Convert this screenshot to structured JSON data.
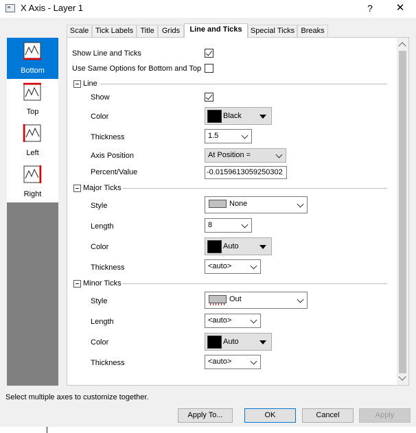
{
  "window": {
    "title": "X Axis - Layer 1",
    "help": "?",
    "close": "✕"
  },
  "axes": [
    {
      "label": "Bottom",
      "selected": true
    },
    {
      "label": "Top",
      "selected": false
    },
    {
      "label": "Left",
      "selected": false
    },
    {
      "label": "Right",
      "selected": false
    }
  ],
  "tabs": [
    "Scale",
    "Tick Labels",
    "Title",
    "Grids",
    "Line and Ticks",
    "Special Ticks",
    "Breaks"
  ],
  "active_tab": "Line and Ticks",
  "options": {
    "show_line_and_ticks": {
      "label": "Show Line and Ticks",
      "checked": true
    },
    "same_options": {
      "label": "Use Same Options for Bottom and Top",
      "checked": false
    }
  },
  "line": {
    "header": "Line",
    "show_label": "Show",
    "show_checked": true,
    "color_label": "Color",
    "color_value": "Black",
    "color_hex": "#000000",
    "thickness_label": "Thickness",
    "thickness_value": "1.5",
    "axis_position_label": "Axis Position",
    "axis_position_value": "At Position =",
    "percent_label": "Percent/Value",
    "percent_value": "-0.0159613059250302"
  },
  "major_ticks": {
    "header": "Major Ticks",
    "style_label": "Style",
    "style_value": "None",
    "length_label": "Length",
    "length_value": "8",
    "color_label": "Color",
    "color_value": "Auto",
    "color_hex": "#000000",
    "thickness_label": "Thickness",
    "thickness_value": "<auto>"
  },
  "minor_ticks": {
    "header": "Minor Ticks",
    "style_label": "Style",
    "style_value": "Out",
    "length_label": "Length",
    "length_value": "<auto>",
    "color_label": "Color",
    "color_value": "Auto",
    "color_hex": "#000000",
    "thickness_label": "Thickness",
    "thickness_value": "<auto>"
  },
  "status_text": "Select multiple axes to customize together.",
  "buttons": {
    "apply_to": "Apply To...",
    "ok": "OK",
    "cancel": "Cancel",
    "apply": "Apply"
  },
  "colors": {
    "selection": "#0078d7",
    "axis_highlight": "#e00000"
  }
}
